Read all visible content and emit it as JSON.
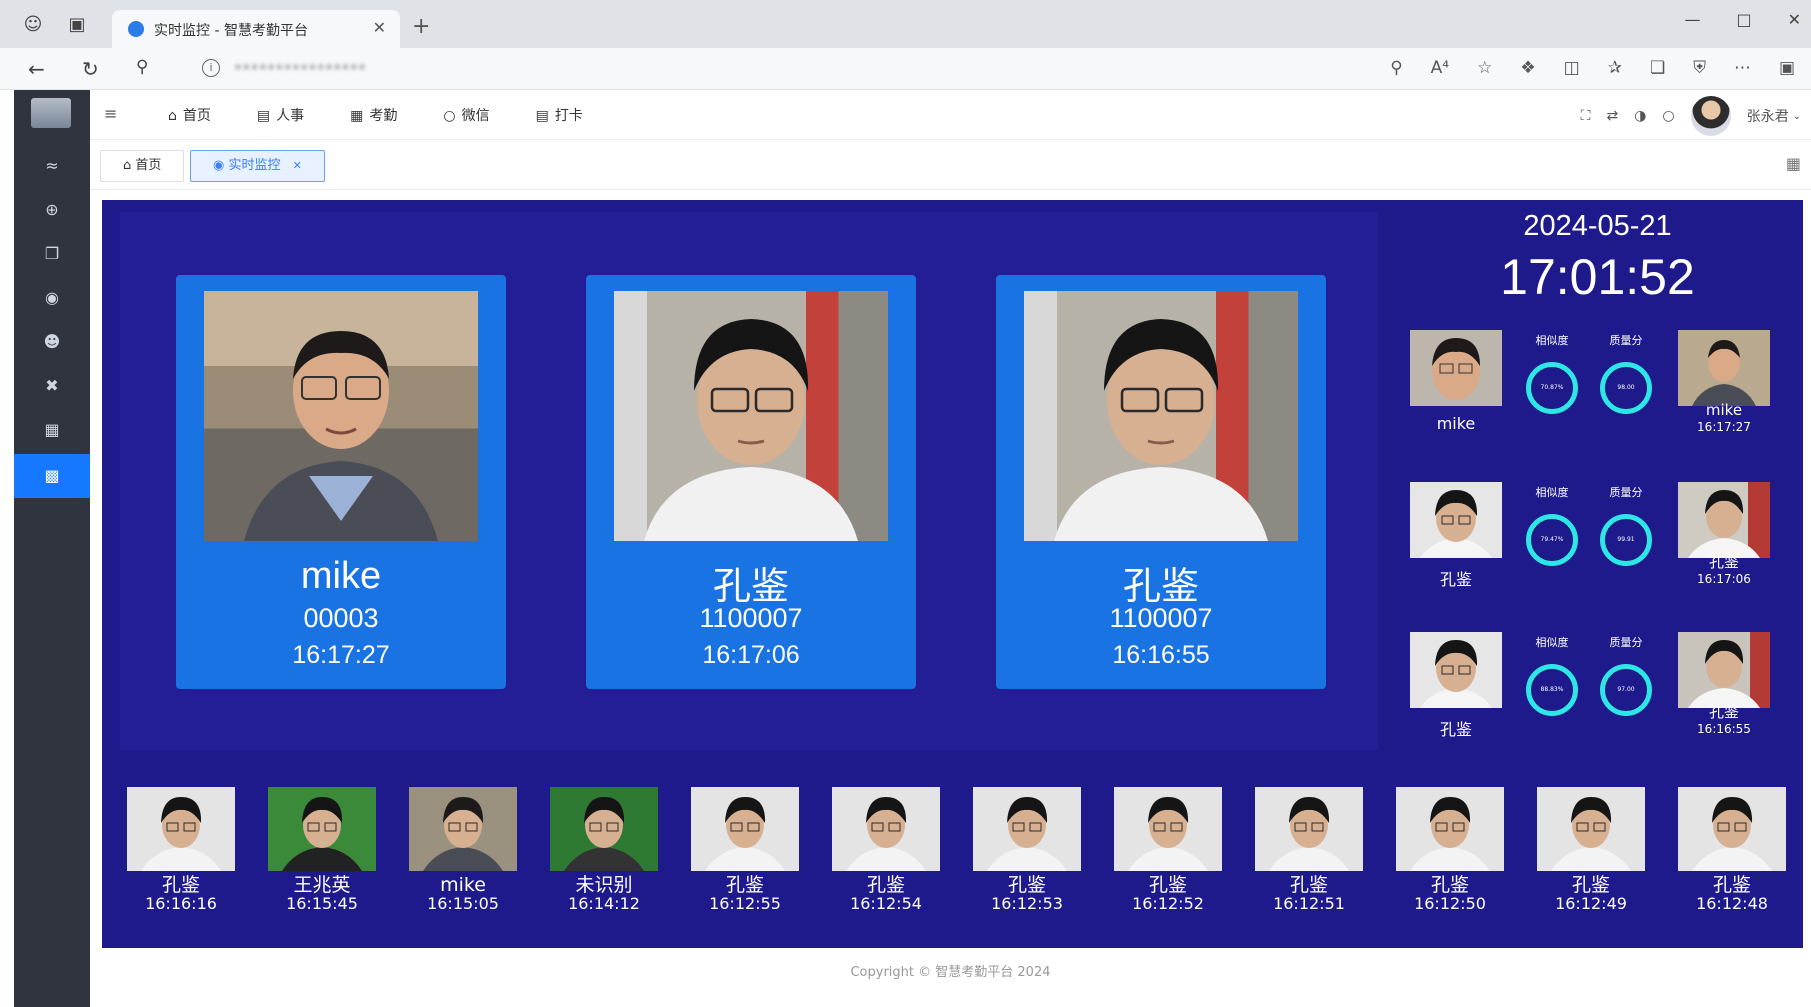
{
  "browser": {
    "tab_title": "实时监控 - 智慧考勤平台",
    "url": "••••••••••••••••"
  },
  "header": {
    "menu": [
      {
        "label": "首页",
        "icon": "home-icon"
      },
      {
        "label": "人事",
        "icon": "person-card-icon"
      },
      {
        "label": "考勤",
        "icon": "calendar-icon"
      },
      {
        "label": "微信",
        "icon": "wechat-icon"
      },
      {
        "label": "打卡",
        "icon": "punch-calendar-icon"
      }
    ],
    "user_name": "张永君"
  },
  "tags": {
    "home": "首页",
    "monitor": "实时监控"
  },
  "sidebar": {
    "icons": [
      "wifi-icon",
      "plus-circle-icon",
      "copy-icon",
      "eye-icon",
      "user-circle-icon",
      "shuffle-icon",
      "image-icon",
      "monitor-icon"
    ]
  },
  "clock": {
    "date": "2024-05-21",
    "time": "17:01:52"
  },
  "main_cards": [
    {
      "name": "mike",
      "code": "00003",
      "time": "16:17:27"
    },
    {
      "name": "孔鉴",
      "code": "1100007",
      "time": "16:17:06"
    },
    {
      "name": "孔鉴",
      "code": "1100007",
      "time": "16:16:55"
    }
  ],
  "comparisons": [
    {
      "left_name": "mike",
      "similarity_label": "相似度",
      "quality_label": "质量分",
      "similarity": "70.87%",
      "quality": "98.00",
      "right_name": "mike",
      "right_time": "16:17:27"
    },
    {
      "left_name": "孔鉴",
      "similarity_label": "相似度",
      "quality_label": "质量分",
      "similarity": "79.47%",
      "quality": "99.91",
      "right_name": "孔鉴",
      "right_time": "16:17:06"
    },
    {
      "left_name": "孔鉴",
      "similarity_label": "相似度",
      "quality_label": "质量分",
      "similarity": "88.83%",
      "quality": "97.00",
      "right_name": "孔鉴",
      "right_time": "16:16:55"
    }
  ],
  "history": [
    {
      "name": "孔鉴",
      "time": "16:16:16"
    },
    {
      "name": "王兆英",
      "time": "16:15:45"
    },
    {
      "name": "mike",
      "time": "16:15:05"
    },
    {
      "name": "未识别",
      "time": "16:14:12"
    },
    {
      "name": "孔鉴",
      "time": "16:12:55"
    },
    {
      "name": "孔鉴",
      "time": "16:12:54"
    },
    {
      "name": "孔鉴",
      "time": "16:12:53"
    },
    {
      "name": "孔鉴",
      "time": "16:12:52"
    },
    {
      "name": "孔鉴",
      "time": "16:12:51"
    },
    {
      "name": "孔鉴",
      "time": "16:12:50"
    },
    {
      "name": "孔鉴",
      "time": "16:12:49"
    },
    {
      "name": "孔鉴",
      "time": "16:12:48"
    }
  ],
  "footer": {
    "text": "Copyright © 智慧考勤平台 2024"
  },
  "colors": {
    "stage_bg": "#1e1a8c",
    "card_bg": "#1a73e3",
    "gauge_ring": "#2ee6e6",
    "sidebar_bg": "#30343f",
    "sidebar_active": "#1677ff"
  }
}
